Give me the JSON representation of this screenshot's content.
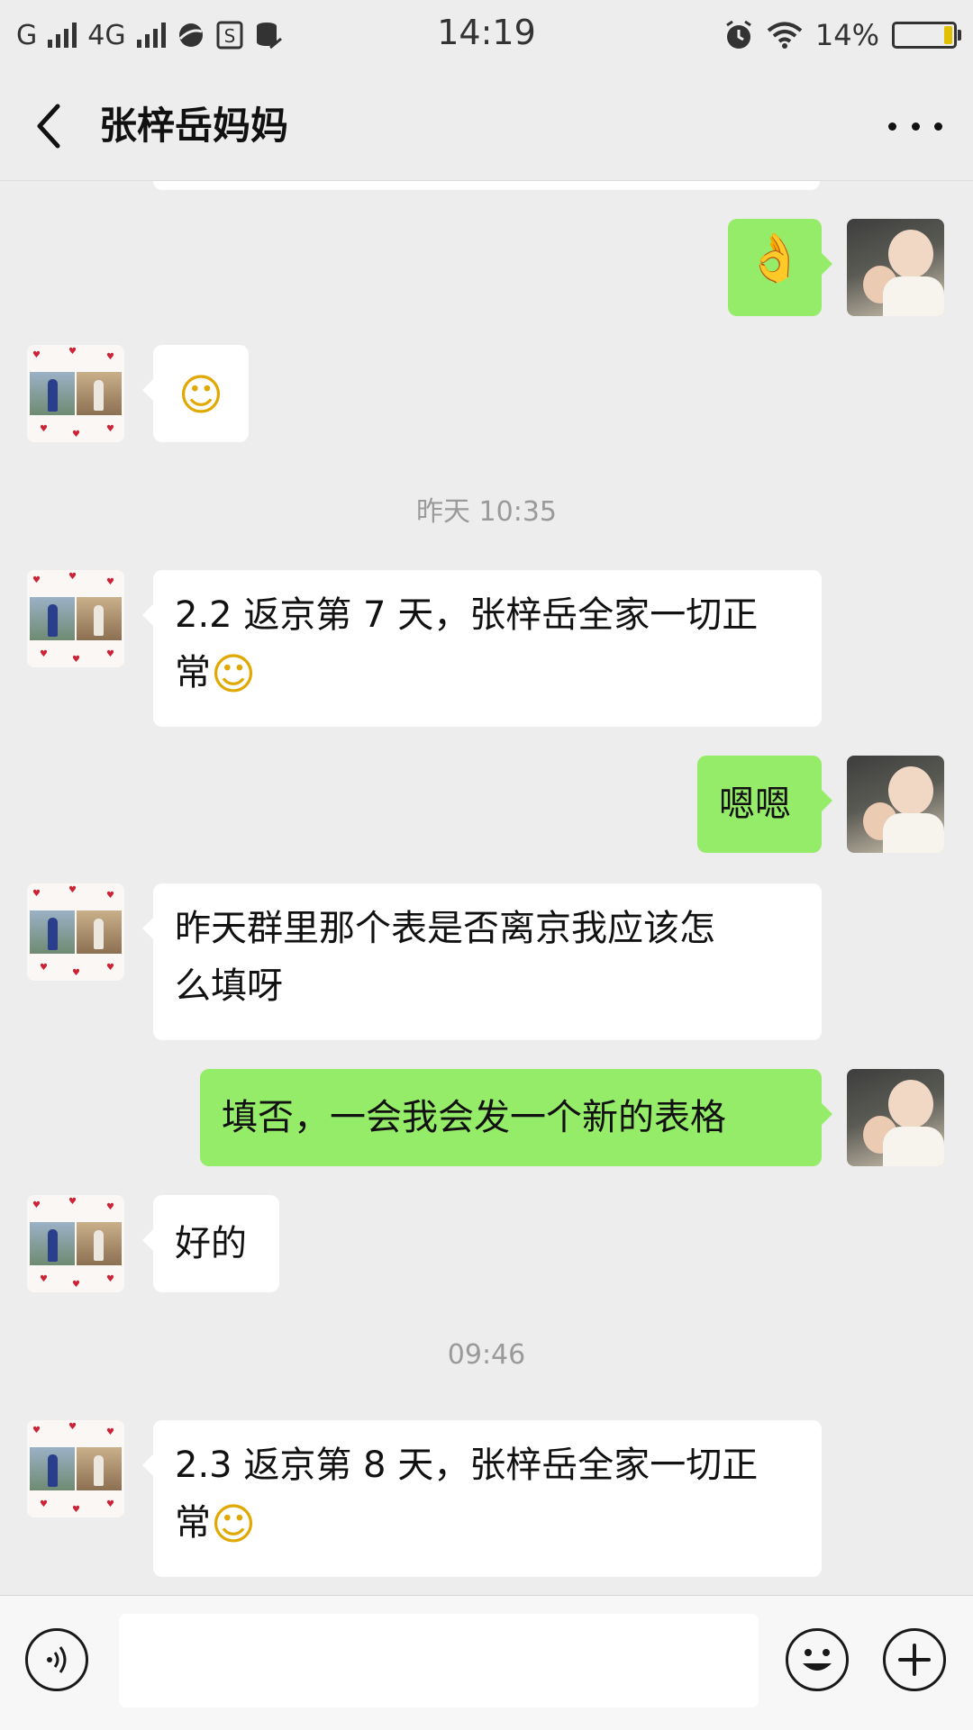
{
  "status_bar": {
    "carrier_1": "G",
    "carrier_2": "4G",
    "time": "14:19",
    "battery": "14%"
  },
  "header": {
    "title": "张梓岳妈妈",
    "back_icon": "chevron-left-icon",
    "more_icon": "more-icon"
  },
  "messages": [
    {
      "side": "right",
      "type": "emoji",
      "text": "👌"
    },
    {
      "side": "left",
      "type": "emoji",
      "text": "☺"
    },
    {
      "type": "timestamp",
      "text": "昨天 10:35"
    },
    {
      "side": "left",
      "type": "text",
      "line1": "2.2 返京第 7 天，张梓岳全家一切正",
      "line2": "常"
    },
    {
      "side": "right",
      "type": "text",
      "text": "嗯嗯"
    },
    {
      "side": "left",
      "type": "text",
      "line1": "昨天群里那个表是否离京我应该怎",
      "line2": "么填呀"
    },
    {
      "side": "right",
      "type": "text",
      "text": "填否，一会我会发一个新的表格"
    },
    {
      "side": "left",
      "type": "text",
      "text": "好的"
    },
    {
      "type": "timestamp",
      "text": "09:46"
    },
    {
      "side": "left",
      "type": "text",
      "line1": "2.3 返京第 8 天，张梓岳全家一切正",
      "line2": "常"
    }
  ],
  "smile_emoji": "☺",
  "input_bar": {
    "placeholder": "",
    "voice_icon": "voice-icon",
    "emoji_icon": "emoji-icon",
    "plus_icon": "plus-icon"
  },
  "colors": {
    "background": "#ededed",
    "bubble_sent": "#95ec69",
    "bubble_received": "#ffffff"
  }
}
